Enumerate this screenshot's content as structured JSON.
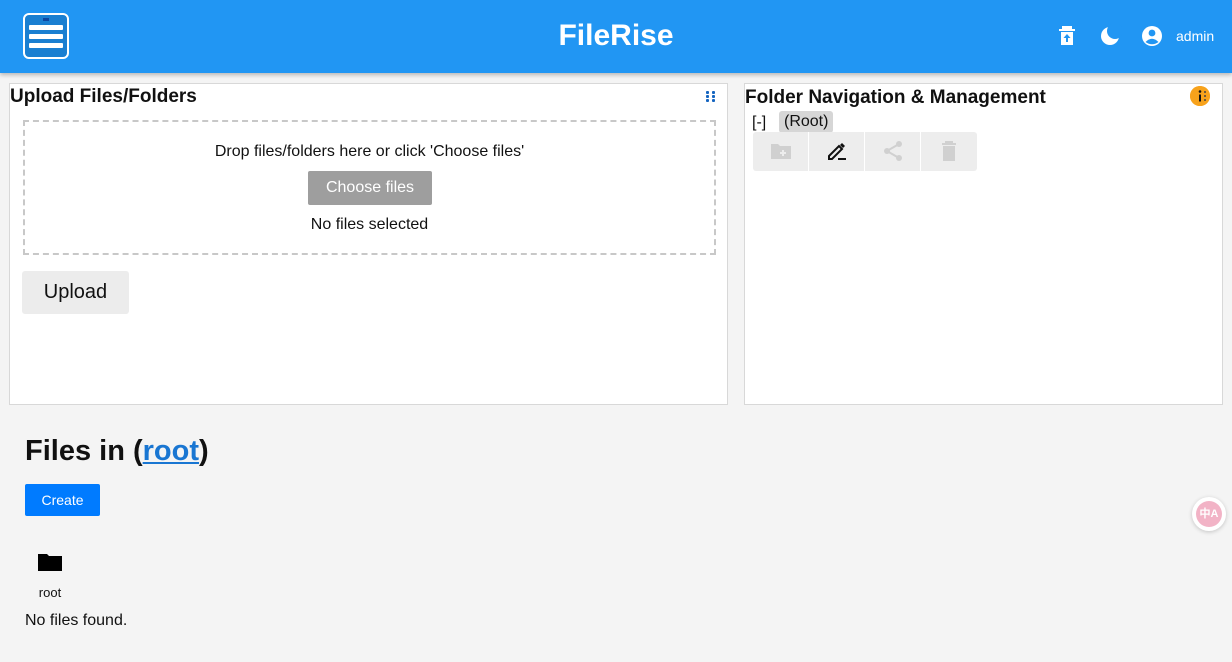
{
  "app": {
    "title": "FileRise",
    "username": "admin"
  },
  "header": {
    "icons": [
      "menu-logo-icon",
      "restore-trash-icon",
      "dark-mode-moon-icon",
      "account-circle-icon"
    ]
  },
  "upload_card": {
    "title": "Upload Files/Folders",
    "drop_text": "Drop files/folders here or click 'Choose files'",
    "choose_label": "Choose files",
    "selected_status": "No files selected",
    "upload_label": "Upload"
  },
  "folder_card": {
    "title": "Folder Navigation & Management",
    "toggle": "[-]",
    "root_label": "(Root)",
    "actions": [
      "create-folder-icon",
      "rename-folder-icon",
      "share-folder-icon",
      "delete-folder-icon"
    ]
  },
  "files_section": {
    "title_prefix": "Files in (",
    "title_link": "root",
    "title_suffix": ")",
    "create_label": "Create",
    "folder_name": "root",
    "empty_message": "No files found."
  },
  "translate_fab": {
    "glyph": "中A"
  },
  "colors": {
    "header_bg": "#2196f3",
    "primary_button": "#007bff",
    "link": "#1976d2",
    "help_badge": "#f7a21b"
  }
}
